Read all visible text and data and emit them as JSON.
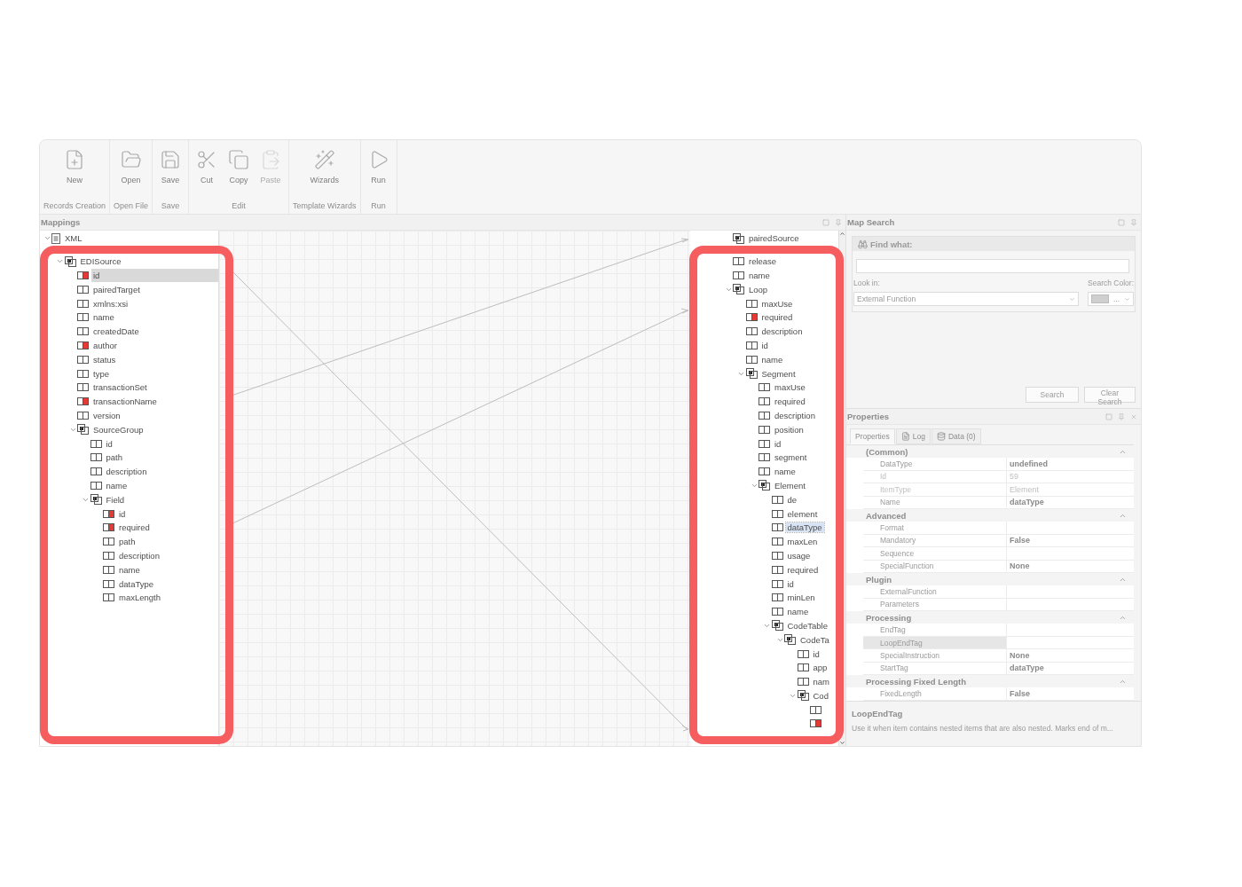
{
  "toolbar": {
    "groups": [
      {
        "label": "Records Creation",
        "buttons": [
          {
            "label": "New",
            "kind": "new",
            "disabled": false
          }
        ]
      },
      {
        "label": "Open File",
        "buttons": [
          {
            "label": "Open",
            "kind": "open",
            "disabled": false
          }
        ]
      },
      {
        "label": "Save",
        "buttons": [
          {
            "label": "Save",
            "kind": "save",
            "disabled": false
          }
        ]
      },
      {
        "label": "Edit",
        "buttons": [
          {
            "label": "Cut",
            "kind": "cut",
            "disabled": false
          },
          {
            "label": "Copy",
            "kind": "copy",
            "disabled": false
          },
          {
            "label": "Paste",
            "kind": "paste",
            "disabled": true
          }
        ]
      },
      {
        "label": "Template Wizards",
        "buttons": [
          {
            "label": "Wizards",
            "kind": "wizard",
            "disabled": false
          }
        ]
      },
      {
        "label": "Run",
        "buttons": [
          {
            "label": "Run",
            "kind": "run",
            "disabled": false
          }
        ]
      }
    ]
  },
  "mappings": {
    "title": "Mappings",
    "source_tree": [
      {
        "label": "XML",
        "kind": "document",
        "flagged": false,
        "selected": false,
        "expanded": true,
        "children": [
          {
            "label": "EDISource",
            "kind": "group",
            "flagged": false,
            "selected": false,
            "expanded": true,
            "children": [
              {
                "label": "id",
                "kind": "field",
                "flagged": true,
                "selected": true
              },
              {
                "label": "pairedTarget",
                "kind": "field",
                "flagged": false,
                "selected": false
              },
              {
                "label": "xmlns:xsi",
                "kind": "field",
                "flagged": false,
                "selected": false
              },
              {
                "label": "name",
                "kind": "field",
                "flagged": false,
                "selected": false
              },
              {
                "label": "createdDate",
                "kind": "field",
                "flagged": false,
                "selected": false
              },
              {
                "label": "author",
                "kind": "field",
                "flagged": true,
                "selected": false
              },
              {
                "label": "status",
                "kind": "field",
                "flagged": false,
                "selected": false
              },
              {
                "label": "type",
                "kind": "field",
                "flagged": false,
                "selected": false
              },
              {
                "label": "transactionSet",
                "kind": "field",
                "flagged": false,
                "selected": false
              },
              {
                "label": "transactionName",
                "kind": "field",
                "flagged": true,
                "selected": false
              },
              {
                "label": "version",
                "kind": "field",
                "flagged": false,
                "selected": false
              },
              {
                "label": "SourceGroup",
                "kind": "group",
                "flagged": false,
                "selected": false,
                "expanded": true,
                "children": [
                  {
                    "label": "id",
                    "kind": "field",
                    "flagged": false,
                    "selected": false
                  },
                  {
                    "label": "path",
                    "kind": "field",
                    "flagged": false,
                    "selected": false
                  },
                  {
                    "label": "description",
                    "kind": "field",
                    "flagged": false,
                    "selected": false
                  },
                  {
                    "label": "name",
                    "kind": "field",
                    "flagged": false,
                    "selected": false
                  },
                  {
                    "label": "Field",
                    "kind": "group",
                    "flagged": false,
                    "selected": false,
                    "expanded": true,
                    "children": [
                      {
                        "label": "id",
                        "kind": "field",
                        "flagged": true,
                        "selected": false
                      },
                      {
                        "label": "required",
                        "kind": "field",
                        "flagged": true,
                        "selected": false
                      },
                      {
                        "label": "path",
                        "kind": "field",
                        "flagged": false,
                        "selected": false
                      },
                      {
                        "label": "description",
                        "kind": "field",
                        "flagged": false,
                        "selected": false
                      },
                      {
                        "label": "name",
                        "kind": "field",
                        "flagged": false,
                        "selected": false
                      },
                      {
                        "label": "dataType",
                        "kind": "field",
                        "flagged": false,
                        "selected": false
                      },
                      {
                        "label": "maxLength",
                        "kind": "field",
                        "flagged": false,
                        "selected": false
                      }
                    ]
                  }
                ]
              }
            ]
          }
        ]
      }
    ],
    "target_tree": [
      {
        "label": "pairedSource",
        "kind": "group",
        "flagged": false,
        "selected": false
      },
      {
        "label": "release",
        "kind": "field",
        "flagged": false,
        "selected": false
      },
      {
        "label": "name",
        "kind": "field",
        "flagged": false,
        "selected": false
      },
      {
        "label": "Loop",
        "kind": "group",
        "flagged": false,
        "selected": false,
        "expanded": true,
        "children": [
          {
            "label": "maxUse",
            "kind": "field",
            "flagged": false,
            "selected": false
          },
          {
            "label": "required",
            "kind": "field",
            "flagged": true,
            "selected": false
          },
          {
            "label": "description",
            "kind": "field",
            "flagged": false,
            "selected": false
          },
          {
            "label": "id",
            "kind": "field",
            "flagged": false,
            "selected": false
          },
          {
            "label": "name",
            "kind": "field",
            "flagged": false,
            "selected": false
          },
          {
            "label": "Segment",
            "kind": "group",
            "flagged": false,
            "selected": false,
            "expanded": true,
            "children": [
              {
                "label": "maxUse",
                "kind": "field",
                "flagged": false,
                "selected": false
              },
              {
                "label": "required",
                "kind": "field",
                "flagged": false,
                "selected": false
              },
              {
                "label": "description",
                "kind": "field",
                "flagged": false,
                "selected": false
              },
              {
                "label": "position",
                "kind": "field",
                "flagged": false,
                "selected": false
              },
              {
                "label": "id",
                "kind": "field",
                "flagged": false,
                "selected": false
              },
              {
                "label": "segment",
                "kind": "field",
                "flagged": false,
                "selected": false
              },
              {
                "label": "name",
                "kind": "field",
                "flagged": false,
                "selected": false
              },
              {
                "label": "Element",
                "kind": "group",
                "flagged": false,
                "selected": false,
                "expanded": true,
                "children": [
                  {
                    "label": "de",
                    "kind": "field",
                    "flagged": false,
                    "selected": false
                  },
                  {
                    "label": "element",
                    "kind": "field",
                    "flagged": false,
                    "selected": false
                  },
                  {
                    "label": "dataType",
                    "kind": "field",
                    "flagged": false,
                    "selected": true
                  },
                  {
                    "label": "maxLen",
                    "kind": "field",
                    "flagged": false,
                    "selected": false
                  },
                  {
                    "label": "usage",
                    "kind": "field",
                    "flagged": false,
                    "selected": false
                  },
                  {
                    "label": "required",
                    "kind": "field",
                    "flagged": false,
                    "selected": false
                  },
                  {
                    "label": "id",
                    "kind": "field",
                    "flagged": false,
                    "selected": false
                  },
                  {
                    "label": "minLen",
                    "kind": "field",
                    "flagged": false,
                    "selected": false
                  },
                  {
                    "label": "name",
                    "kind": "field",
                    "flagged": false,
                    "selected": false
                  },
                  {
                    "label": "CodeTable",
                    "kind": "group",
                    "flagged": false,
                    "selected": false,
                    "expanded": true,
                    "children": [
                      {
                        "label": "CodeTa",
                        "kind": "group",
                        "flagged": false,
                        "selected": false,
                        "expanded": true,
                        "children": [
                          {
                            "label": "id",
                            "kind": "field",
                            "flagged": false,
                            "selected": false
                          },
                          {
                            "label": "app",
                            "kind": "field",
                            "flagged": false,
                            "selected": false
                          },
                          {
                            "label": "nam",
                            "kind": "field",
                            "flagged": false,
                            "selected": false
                          },
                          {
                            "label": "Cod",
                            "kind": "group",
                            "flagged": false,
                            "selected": false,
                            "expanded": true,
                            "children": [
                              {
                                "kind": "field",
                                "flagged": false,
                                "selected": false
                              },
                              {
                                "kind": "field",
                                "flagged": true,
                                "selected": false
                              }
                            ]
                          }
                        ]
                      }
                    ]
                  }
                ]
              }
            ]
          }
        ]
      }
    ]
  },
  "map_search": {
    "title": "Map Search",
    "find_label": "Find what:",
    "look_in_label": "Look in:",
    "look_in_value": "External Function",
    "search_color_label": "Search Color:",
    "search_color_value": "...",
    "buttons": [
      "Search",
      "Clear Search"
    ]
  },
  "properties": {
    "title": "Properties",
    "tabs": [
      {
        "label": "Properties",
        "kind": "plain",
        "selected": true
      },
      {
        "label": "Log",
        "kind": "log",
        "selected": false
      },
      {
        "label": "Data (0)",
        "kind": "data",
        "selected": false
      }
    ],
    "categories": [
      {
        "name": "(Common)",
        "expanded": true,
        "rows": [
          {
            "name": "DataType",
            "value": "undefined",
            "readonly": false,
            "selected": false
          },
          {
            "name": "Id",
            "value": "59",
            "readonly": true,
            "selected": false
          },
          {
            "name": "ItemType",
            "value": "Element",
            "readonly": true,
            "selected": false
          },
          {
            "name": "Name",
            "value": "dataType",
            "readonly": false,
            "selected": false
          }
        ]
      },
      {
        "name": "Advanced",
        "expanded": true,
        "rows": [
          {
            "name": "Format",
            "readonly": false,
            "selected": false
          },
          {
            "name": "Mandatory",
            "value": "False",
            "readonly": false,
            "selected": false
          },
          {
            "name": "Sequence",
            "readonly": false,
            "selected": false
          },
          {
            "name": "SpecialFunction",
            "value": "None",
            "readonly": false,
            "selected": false
          }
        ]
      },
      {
        "name": "Plugin",
        "expanded": true,
        "rows": [
          {
            "name": "ExternalFunction",
            "readonly": false,
            "selected": false
          },
          {
            "name": "Parameters",
            "readonly": false,
            "selected": false
          }
        ]
      },
      {
        "name": "Processing",
        "expanded": true,
        "rows": [
          {
            "name": "EndTag",
            "readonly": false,
            "selected": false
          },
          {
            "name": "LoopEndTag",
            "readonly": false,
            "selected": true
          },
          {
            "name": "SpecialInstruction",
            "value": "None",
            "readonly": false,
            "selected": false
          },
          {
            "name": "StartTag",
            "value": "dataType",
            "readonly": false,
            "selected": false
          }
        ]
      },
      {
        "name": "Processing Fixed Length",
        "expanded": true,
        "rows": [
          {
            "name": "FixedLength",
            "value": "False",
            "readonly": false,
            "selected": false
          }
        ]
      }
    ],
    "description": {
      "title": "LoopEndTag",
      "text": "Use it when item contains nested items that are also nested. Marks end of m..."
    }
  }
}
